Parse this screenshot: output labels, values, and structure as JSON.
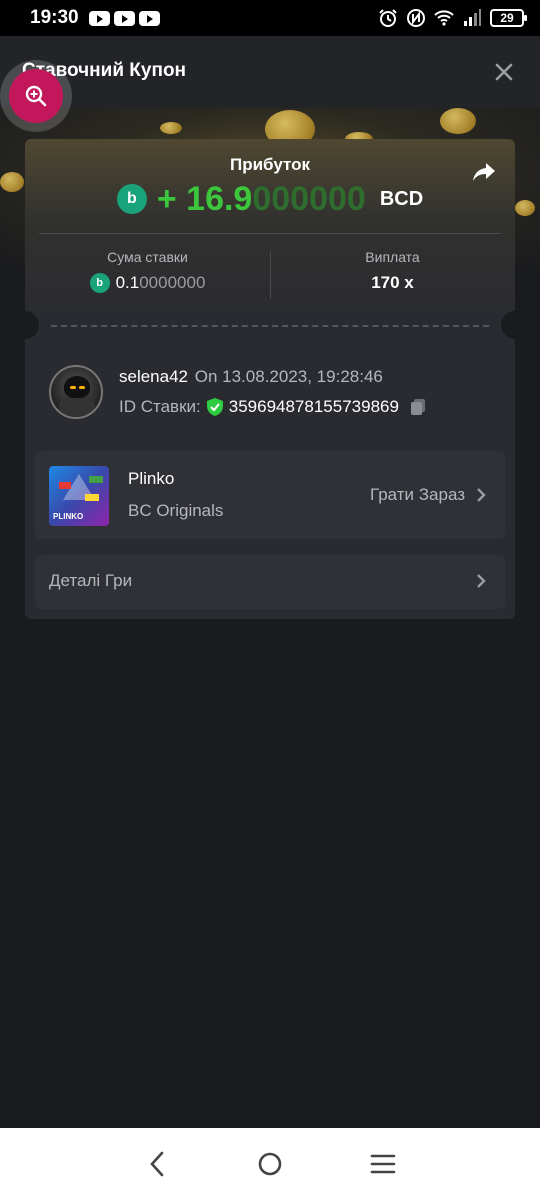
{
  "status_bar": {
    "time": "19:30",
    "battery": "29",
    "icons": [
      "youtube-icon",
      "youtube-icon",
      "youtube-icon",
      "alarm-icon",
      "nfc-icon",
      "wifi-icon",
      "signal-icon",
      "battery-icon"
    ]
  },
  "header": {
    "title": "Ставочний Купон",
    "close_icon": "close-icon",
    "zoom_icon": "zoom-in-icon"
  },
  "profit": {
    "label": "Прибуток",
    "sign": "+",
    "amount_main": "16.9",
    "amount_trailing": "000000",
    "currency": "BCD",
    "currency_icon": "bcd-coin-icon",
    "share_icon": "share-icon"
  },
  "stats": {
    "bet_amount_label": "Сума ставки",
    "bet_amount_main": "0.1",
    "bet_amount_trailing": "0000000",
    "payout_label": "Виплата",
    "payout_value": "170 x"
  },
  "user": {
    "name": "selena42",
    "on_date": "On 13.08.2023, 19:28:46",
    "bet_id_label": "ID Ставки:",
    "bet_id": "359694878155739869",
    "copy_icon": "copy-icon",
    "verified_icon": "shield-check-icon"
  },
  "game": {
    "name": "Plinko",
    "provider": "BC Originals",
    "thumb_text": "PLINKO",
    "play_label": "Грати Зараз"
  },
  "details": {
    "label": "Деталі Гри"
  },
  "colors": {
    "profit_green": "#3cc63c",
    "bcd_coin": "#1aa37a",
    "zoom_pink": "#c2185b",
    "verified_green": "#2ecc40"
  }
}
